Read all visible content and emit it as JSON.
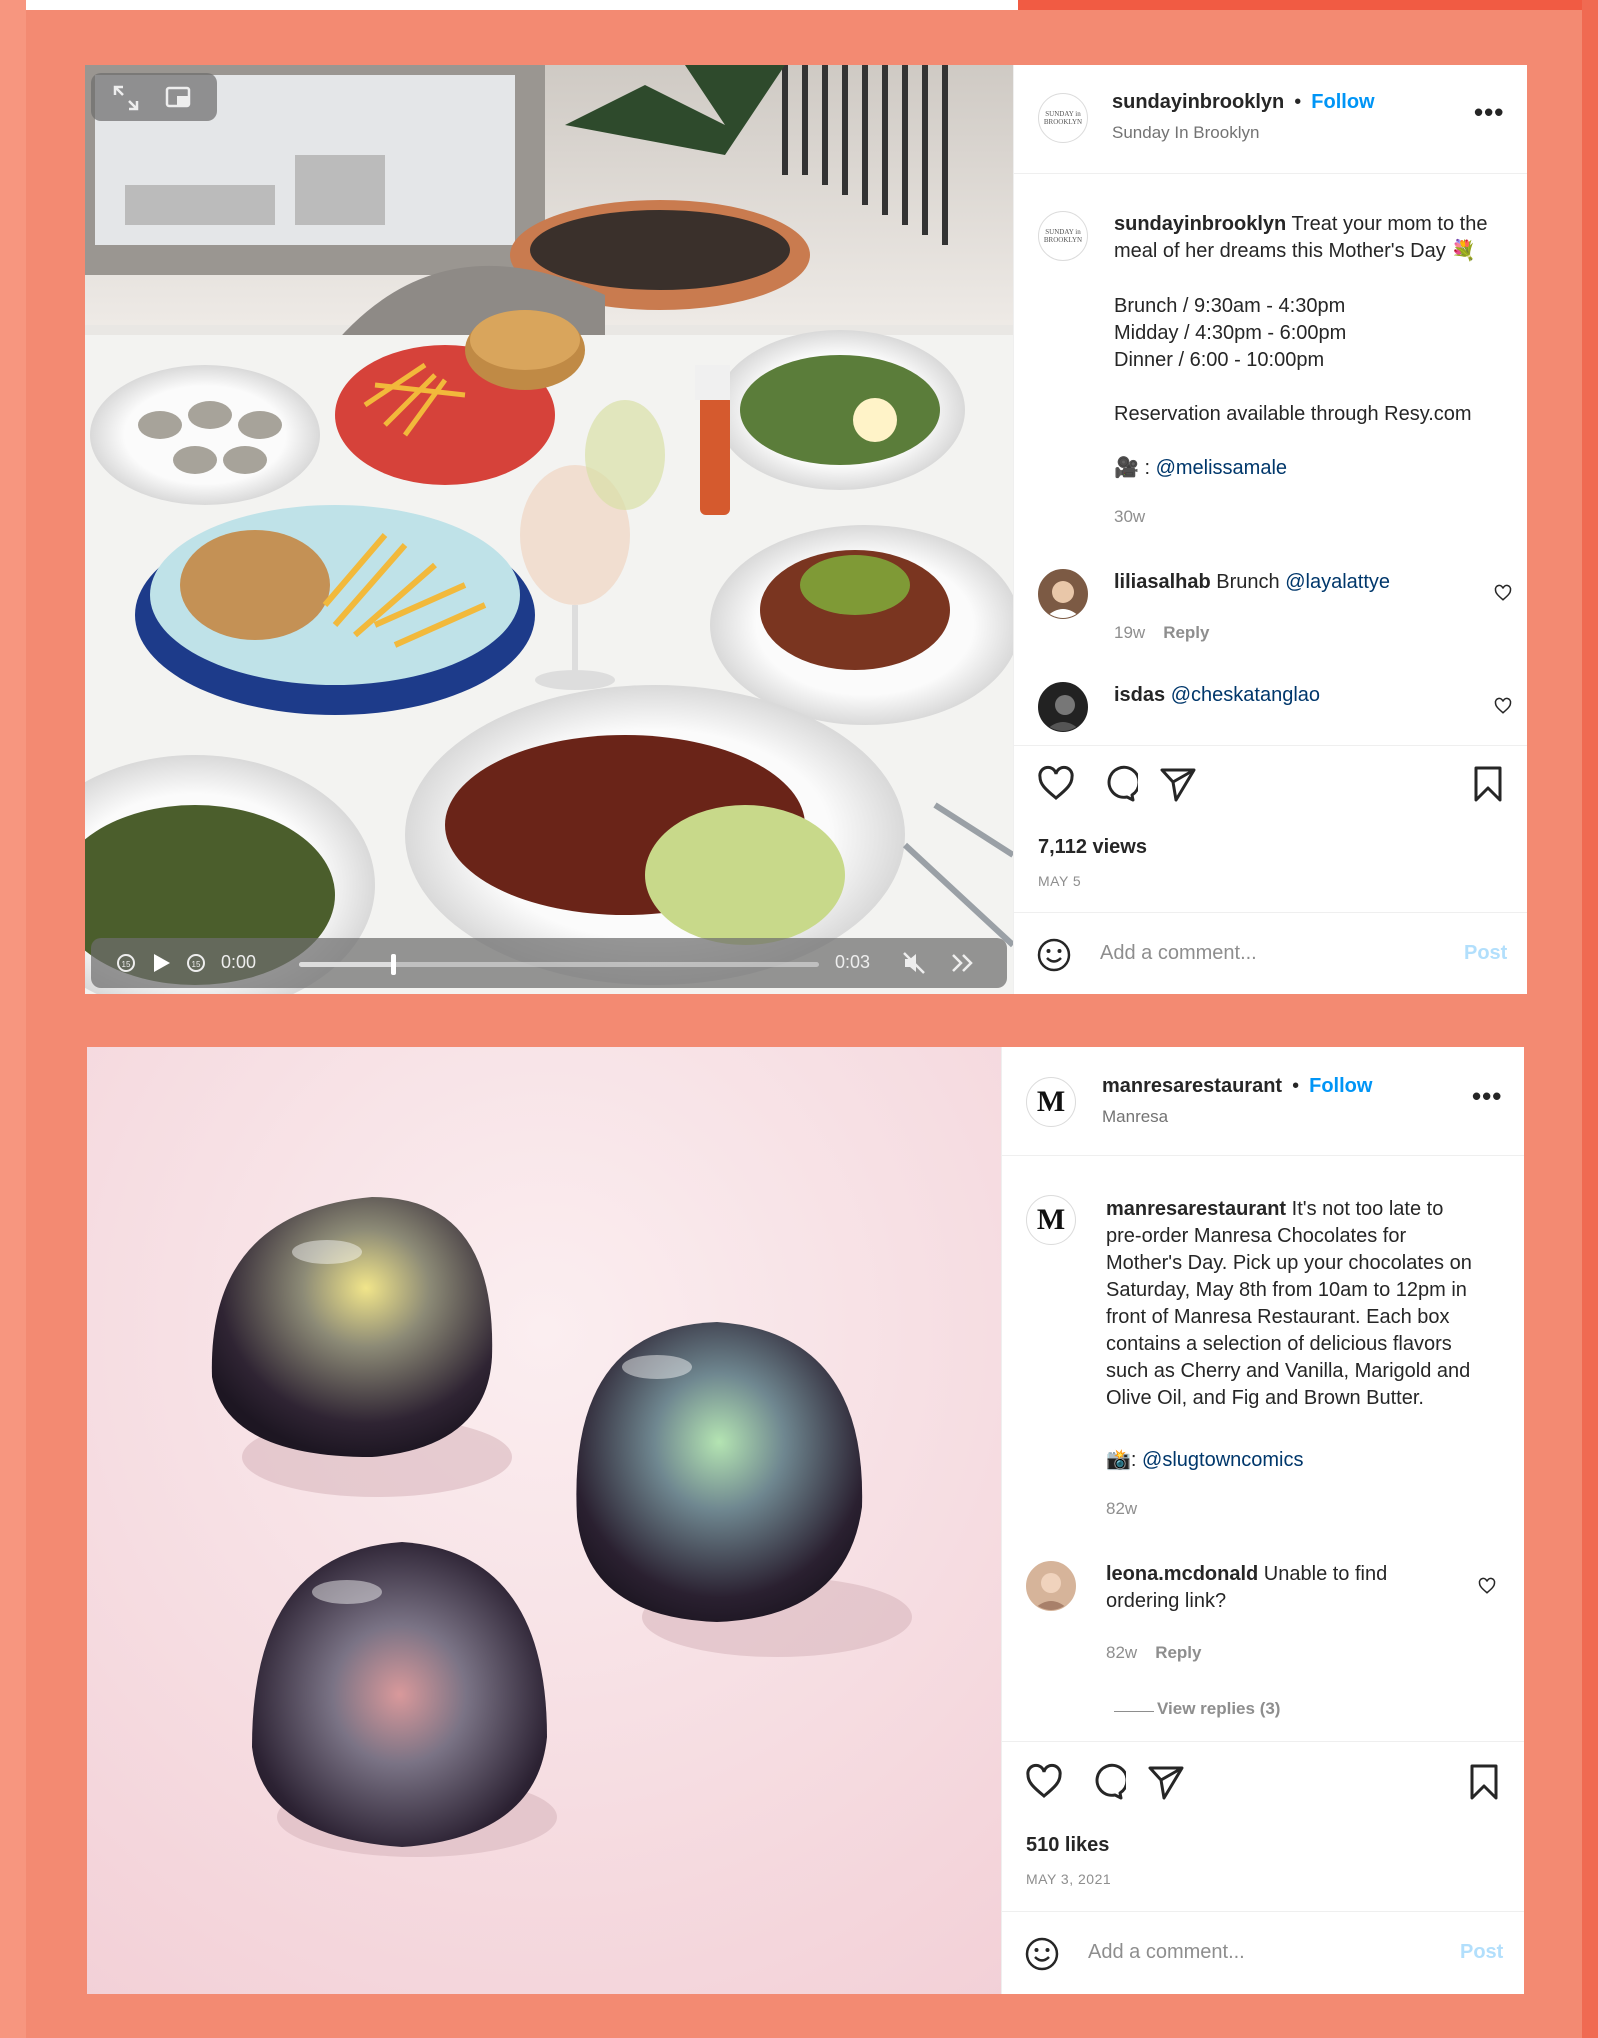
{
  "colors": {
    "accent": "#0095f6",
    "background": "#f38a72",
    "post_disabled": "#b2dffc"
  },
  "post1": {
    "avatar_text": "SUNDAY in BROOKLYN",
    "username": "sundayinbrooklyn",
    "follow_label": "Follow",
    "subtitle": "Sunday In Brooklyn",
    "more_icon": "more-icon",
    "caption_username": "sundayinbrooklyn",
    "caption_text": " Treat your mom to the meal of her dreams this Mother's Day 💐",
    "hours_line1": "Brunch / 9:30am - 4:30pm",
    "hours_line2": "Midday / 4:30pm - 6:00pm",
    "hours_line3": "Dinner / 6:00 - 10:00pm",
    "reservation": "Reservation available through Resy.com",
    "credit_prefix": "🎥 : ",
    "credit_mention": "@melissamale",
    "caption_age": "30w",
    "comments": [
      {
        "username": "liliasalhab",
        "text": " Brunch ",
        "mention": "@layalattye",
        "age": "19w",
        "reply": "Reply"
      },
      {
        "username": "isdas",
        "text": " ",
        "mention": "@cheskatanglao"
      }
    ],
    "views": "7,112 views",
    "date": "MAY 5",
    "comment_placeholder": "Add a comment...",
    "post_label": "Post",
    "video": {
      "current_time": "0:00",
      "duration": "0:03",
      "progress": 0.18
    }
  },
  "post2": {
    "avatar_letter": "M",
    "username": "manresarestaurant",
    "follow_label": "Follow",
    "subtitle": "Manresa",
    "caption_username": "manresarestaurant",
    "caption_lines": [
      " It's not too late to",
      "pre-order Manresa Chocolates for",
      "Mother's Day. Pick up your chocolates on",
      "Saturday, May 8th from 10am to 12pm in",
      "front of Manresa Restaurant. Each box",
      "contains a selection of delicious flavors",
      "such as Cherry and Vanilla, Marigold and",
      "Olive Oil, and Fig and Brown Butter."
    ],
    "credit_prefix": "📸: ",
    "credit_mention": "@slugtowncomics",
    "caption_age": "82w",
    "comment": {
      "username": "leona.mcdonald",
      "text_line1": " Unable to find",
      "text_line2": "ordering link?",
      "age": "82w",
      "reply": "Reply"
    },
    "view_replies": "View replies (3)",
    "likes": "510 likes",
    "date": "MAY 3, 2021",
    "comment_placeholder": "Add a comment...",
    "post_label": "Post"
  }
}
